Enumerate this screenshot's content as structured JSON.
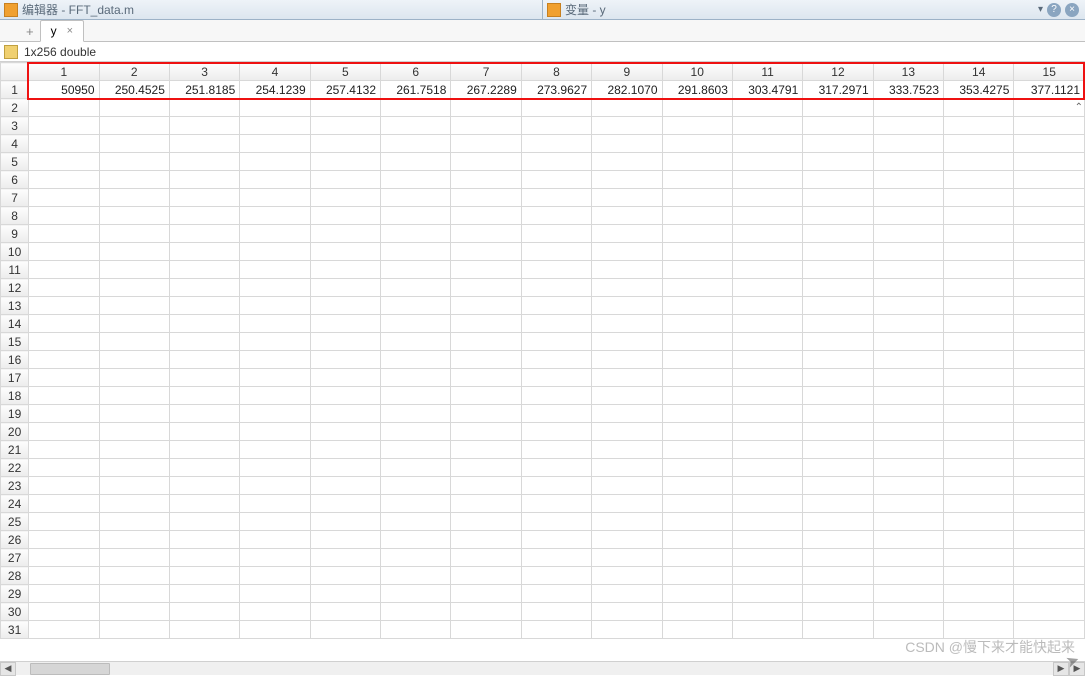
{
  "title_left": {
    "icon": "editor-icon",
    "label": "编辑器 - FFT_data.m"
  },
  "title_right": {
    "icon": "variable-icon",
    "label": "变量 - y"
  },
  "tab": {
    "label": "y",
    "close": "×"
  },
  "plus": "+",
  "type_info": "1x256 double",
  "columns": [
    "1",
    "2",
    "3",
    "4",
    "5",
    "6",
    "7",
    "8",
    "9",
    "10",
    "11",
    "12",
    "13",
    "14",
    "15"
  ],
  "row1": [
    "50950",
    "250.4525",
    "251.8185",
    "254.1239",
    "257.4132",
    "261.7518",
    "267.2289",
    "273.9627",
    "282.1070",
    "291.8603",
    "303.4791",
    "317.2971",
    "333.7523",
    "353.4275",
    "377.1121"
  ],
  "row_headers": [
    "2",
    "3",
    "4",
    "5",
    "6",
    "7",
    "8",
    "9",
    "10",
    "11",
    "12",
    "13",
    "14",
    "15",
    "16",
    "17",
    "18",
    "19",
    "20",
    "21",
    "22",
    "23",
    "24",
    "25",
    "26",
    "27",
    "28",
    "29",
    "30",
    "31"
  ],
  "controls": {
    "dropdown": "▾",
    "close": "×",
    "minimize": "–"
  },
  "scroll": {
    "up": "⌃",
    "left": "◀",
    "right": "▶"
  },
  "watermark": "CSDN @慢下来才能快起来"
}
